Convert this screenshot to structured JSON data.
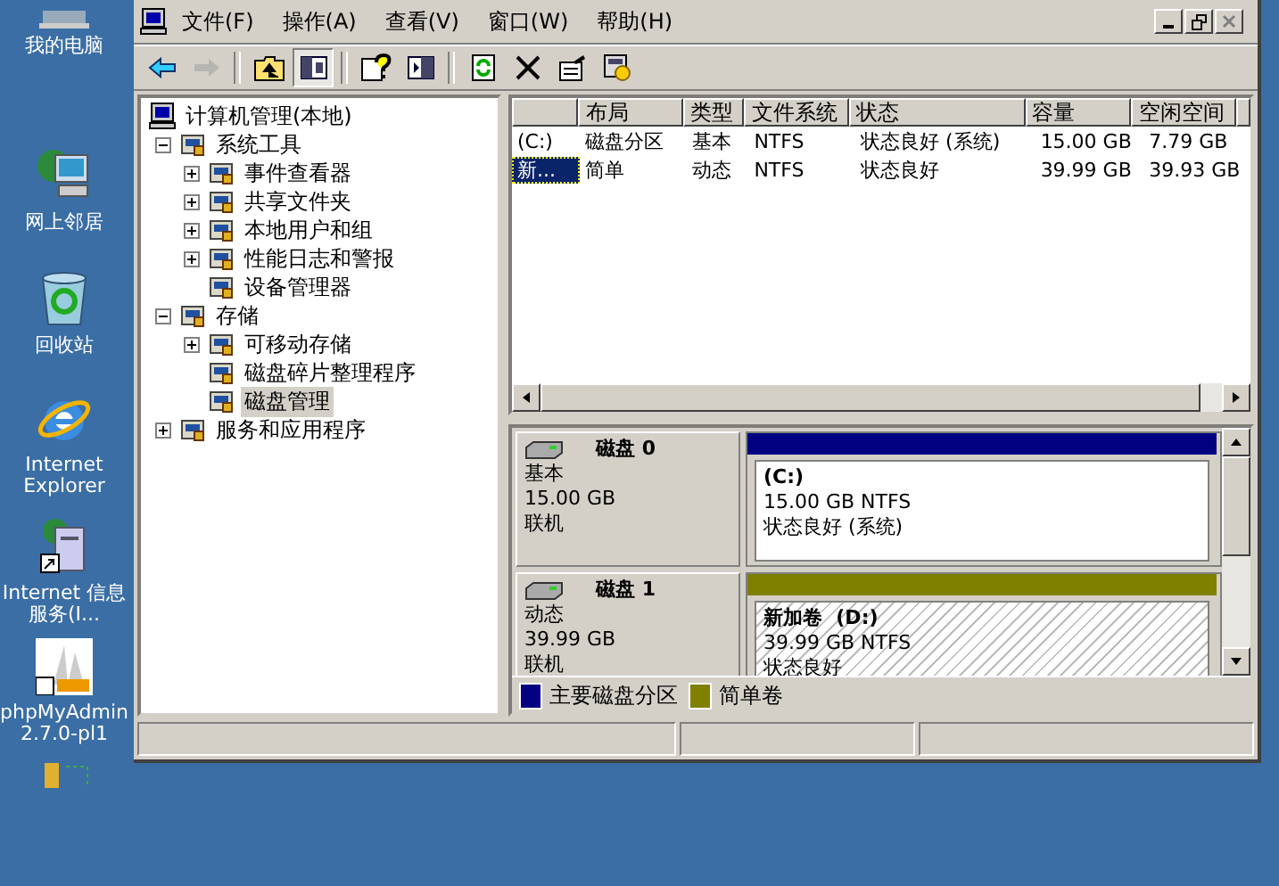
{
  "desktop": {
    "icons": [
      {
        "kind": "computer",
        "label": "我的电脑"
      },
      {
        "kind": "network",
        "label": "网上邻居"
      },
      {
        "kind": "recycle",
        "label": "回收站"
      },
      {
        "kind": "browser",
        "label": "Internet Explorer"
      },
      {
        "kind": "server",
        "label": "Internet 信息服务(I..."
      },
      {
        "kind": "sail",
        "label": "phpMyAdmin 2.7.0-pl1"
      },
      {
        "kind": "database"
      }
    ]
  },
  "window": {
    "menu": [
      "文件(F)",
      "操作(A)",
      "查看(V)",
      "窗口(W)",
      "帮助(H)"
    ],
    "controls": [
      {
        "kind": "minimize",
        "disabled": false
      },
      {
        "kind": "restore",
        "disabled": false
      },
      {
        "kind": "close",
        "disabled": true
      }
    ],
    "toolbar": [
      {
        "kind": "back",
        "disabled": false,
        "selected": false
      },
      {
        "kind": "forward",
        "disabled": true,
        "selected": false
      },
      {
        "kind": "up",
        "disabled": false,
        "selected": false
      },
      {
        "kind": "tree",
        "disabled": false,
        "selected": true
      },
      {
        "kind": "help",
        "disabled": false,
        "selected": false
      },
      {
        "kind": "panel",
        "disabled": false,
        "selected": false
      },
      {
        "kind": "refresh",
        "disabled": false,
        "selected": false
      },
      {
        "kind": "delete",
        "disabled": false,
        "selected": false
      },
      {
        "kind": "properties",
        "disabled": false,
        "selected": false
      },
      {
        "kind": "wizard",
        "disabled": false,
        "selected": false
      }
    ]
  },
  "tree": {
    "label": "计算机管理(本地)",
    "selected": false,
    "children": [
      {
        "label": "系统工具",
        "expanded": true,
        "selected": false,
        "children": [
          {
            "label": "事件查看器",
            "expanded": false,
            "selected": false
          },
          {
            "label": "共享文件夹",
            "expanded": false,
            "selected": false
          },
          {
            "label": "本地用户和组",
            "expanded": false,
            "selected": false
          },
          {
            "label": "性能日志和警报",
            "expanded": false,
            "selected": false
          },
          {
            "label": "设备管理器",
            "selected": false
          }
        ]
      },
      {
        "label": "存储",
        "expanded": true,
        "selected": false,
        "children": [
          {
            "label": "可移动存储",
            "expanded": false,
            "selected": false
          },
          {
            "label": "磁盘碎片整理程序",
            "selected": false
          },
          {
            "label": "磁盘管理",
            "selected": true
          }
        ]
      },
      {
        "label": "服务和应用程序",
        "expanded": false,
        "selected": false
      }
    ]
  },
  "volume_list": {
    "columns": [
      "",
      "布局",
      "类型",
      "文件系统",
      "状态",
      "容量",
      "空闲空间"
    ],
    "rows": [
      {
        "cells": [
          "(C:)",
          "磁盘分区",
          "基本",
          "NTFS",
          "状态良好 (系统)",
          "15.00 GB",
          "7.79 GB"
        ],
        "selected": false
      },
      {
        "cells": [
          "新...",
          "简单",
          "动态",
          "NTFS",
          "状态良好",
          "39.99 GB",
          "39.93 GB"
        ],
        "selected": true
      }
    ]
  },
  "disks": [
    {
      "name": "磁盘 0",
      "type": "基本",
      "size": "15.00 GB",
      "status": "联机",
      "color": "#000080",
      "volume": {
        "label": "(C:)",
        "size": "15.00 GB NTFS",
        "status": "状态良好 (系统)",
        "selected": false
      }
    },
    {
      "name": "磁盘 1",
      "type": "动态",
      "size": "39.99 GB",
      "status": "联机",
      "color": "#808000",
      "volume": {
        "label": "新加卷  (D:)",
        "size": "39.99 GB NTFS",
        "status": "状态良好",
        "selected": true
      }
    }
  ],
  "legend": [
    {
      "label": "主要磁盘分区",
      "color": "#000080"
    },
    {
      "label": "简单卷",
      "color": "#808000"
    }
  ]
}
